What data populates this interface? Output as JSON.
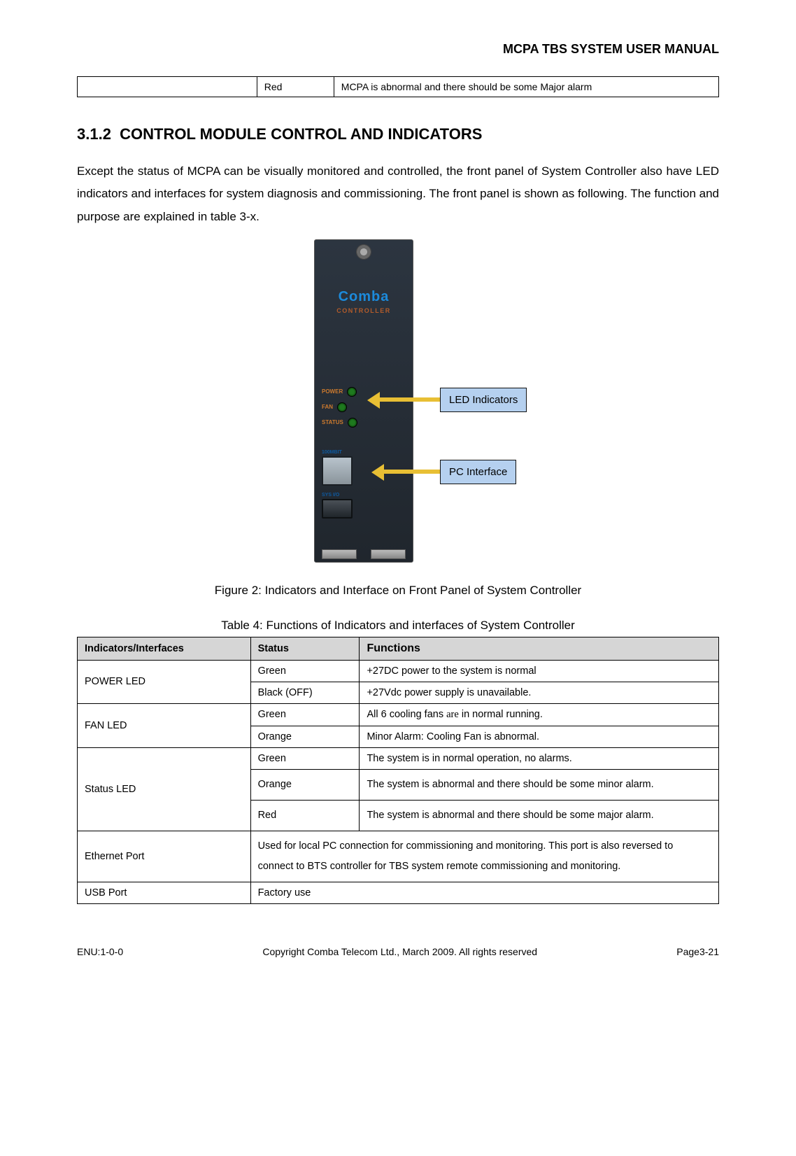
{
  "header": {
    "title": "MCPA TBS SYSTEM USER MANUAL"
  },
  "alarm_row": {
    "col1": "",
    "col2": "Red",
    "col3": "MCPA is abnormal and there should be some Major alarm"
  },
  "section": {
    "number": "3.1.2",
    "title": "CONTROL MODULE CONTROL AND INDICATORS"
  },
  "paragraph": "Except the status of MCPA can be visually monitored and controlled, the front panel of System Controller also have LED indicators and interfaces for system diagnosis and commissioning. The front panel is shown as following. The function and purpose are explained in table 3-x.",
  "device": {
    "brand": "Comba",
    "brand_sub": "CONTROLLER",
    "leds": [
      "POWER",
      "FAN",
      "STATUS"
    ],
    "port_label": "100MBIT",
    "bottom_port_label": "SYS I/O"
  },
  "callouts": {
    "led": "LED Indicators",
    "pc": "PC Interface"
  },
  "figure_caption": "Figure 2: Indicators and Interface on Front Panel of System Controller",
  "table_caption": "Table 4: Functions of Indicators and interfaces of System Controller",
  "table_headers": {
    "c1": "Indicators/Interfaces",
    "c2": "Status",
    "c3": "Functions"
  },
  "table": {
    "power": {
      "name": "POWER LED",
      "rows": [
        {
          "status": "Green",
          "func": "+27DC power to the system is normal"
        },
        {
          "status": "Black (OFF)",
          "func": "+27Vdc power supply is unavailable."
        }
      ]
    },
    "fan": {
      "name": "FAN LED",
      "rows": [
        {
          "status": "Green",
          "func_pre": "All 6 cooling fans ",
          "func_mono": "are",
          "func_post": " in normal running."
        },
        {
          "status": "Orange",
          "func": "Minor Alarm: Cooling Fan is abnormal."
        }
      ]
    },
    "status": {
      "name": "Status LED",
      "rows": [
        {
          "status": "Green",
          "func": "The system is in normal operation, no alarms."
        },
        {
          "status": "Orange",
          "func": "The system is abnormal and there should be some minor alarm."
        },
        {
          "status": "Red",
          "func": "The system is abnormal and there should be some major alarm."
        }
      ]
    },
    "ethernet": {
      "name": "Ethernet Port",
      "desc": "Used for local PC connection for commissioning and monitoring. This port is also reversed to connect to BTS controller for TBS system remote commissioning and monitoring."
    },
    "usb": {
      "name": "USB Port",
      "desc": "Factory use"
    }
  },
  "footer": {
    "left": "ENU:1-0-0",
    "center": "Copyright Comba Telecom Ltd., March 2009. All rights reserved",
    "right": "Page3-21"
  }
}
